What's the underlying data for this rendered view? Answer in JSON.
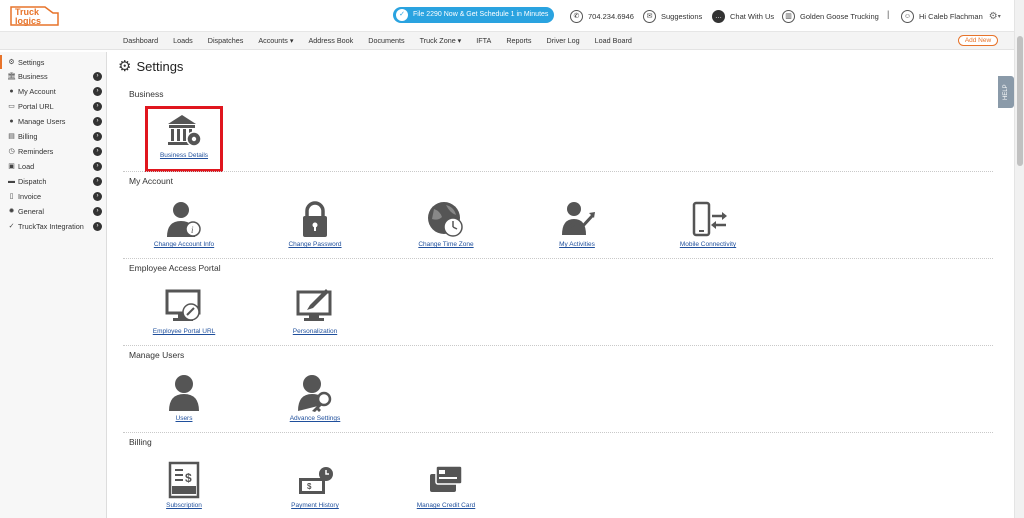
{
  "brand": {
    "line1": "Truck",
    "line2": "logics"
  },
  "header": {
    "promo": "File 2290 Now & Get Schedule 1 in Minutes",
    "phone": "704.234.6946",
    "suggestions": "Suggestions",
    "chat": "Chat With Us",
    "company": "Golden Goose Trucking",
    "separator": "|",
    "greeting": "Hi Caleb Flachman"
  },
  "nav": {
    "items": [
      "Dashboard",
      "Loads",
      "Dispatches",
      "Accounts ▾",
      "Address Book",
      "Documents",
      "Truck Zone ▾",
      "IFTA",
      "Reports",
      "Driver Log",
      "Load Board"
    ],
    "add_new": "Add New"
  },
  "sidebar": {
    "items": [
      {
        "label": "Settings",
        "icon": "gear-icon"
      },
      {
        "label": "Business",
        "icon": "bank-icon"
      },
      {
        "label": "My Account",
        "icon": "user-icon"
      },
      {
        "label": "Portal URL",
        "icon": "link-icon"
      },
      {
        "label": "Manage Users",
        "icon": "users-icon"
      },
      {
        "label": "Billing",
        "icon": "bill-icon"
      },
      {
        "label": "Reminders",
        "icon": "clock-icon"
      },
      {
        "label": "Load",
        "icon": "box-icon"
      },
      {
        "label": "Dispatch",
        "icon": "truck-icon"
      },
      {
        "label": "Invoice",
        "icon": "document-icon"
      },
      {
        "label": "General",
        "icon": "gear-icon"
      },
      {
        "label": "TruckTax Integration",
        "icon": "tax-icon"
      }
    ]
  },
  "main": {
    "title": "Settings",
    "sections": {
      "business": {
        "title": "Business",
        "tiles": [
          "Business Details"
        ]
      },
      "my_account": {
        "title": "My Account",
        "tiles": [
          "Change Account Info",
          "Change Password",
          "Change Time Zone",
          "My Activities",
          "Mobile Connectivity"
        ]
      },
      "employee": {
        "title": "Employee Access Portal",
        "tiles": [
          "Employee Portal URL",
          "Personalization"
        ]
      },
      "manage_users": {
        "title": "Manage Users",
        "tiles": [
          "Users",
          "Advance Settings"
        ]
      },
      "billing": {
        "title": "Billing",
        "tiles": [
          "Subscription",
          "Payment History",
          "Manage Credit Card"
        ]
      }
    }
  },
  "help": "HELP",
  "colors": {
    "accent": "#e7732a",
    "promo": "#2aa3e0",
    "link": "#1f4f9c",
    "highlight": "#e0161e",
    "icon": "#555555"
  }
}
